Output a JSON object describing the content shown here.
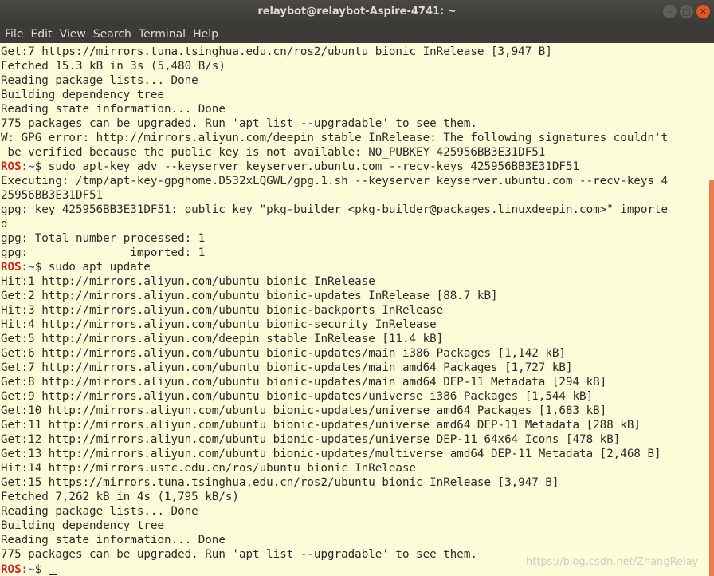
{
  "window": {
    "title": "relaybot@relaybot-Aspire-4741: ~"
  },
  "menu": [
    "File",
    "Edit",
    "View",
    "Search",
    "Terminal",
    "Help"
  ],
  "prompt": {
    "host": "ROS:",
    "path": "~",
    "symbol": "$"
  },
  "lines": [
    {
      "text": "Get:7 https://mirrors.tuna.tsinghua.edu.cn/ros2/ubuntu bionic InRelease [3,947 B]"
    },
    {
      "text": "Fetched 15.3 kB in 3s (5,480 B/s)"
    },
    {
      "text": "Reading package lists... Done"
    },
    {
      "text": "Building dependency tree"
    },
    {
      "text": "Reading state information... Done"
    },
    {
      "text": "775 packages can be upgraded. Run 'apt list --upgradable' to see them."
    },
    {
      "text": "W: GPG error: http://mirrors.aliyun.com/deepin stable InRelease: The following signatures couldn't"
    },
    {
      "text": " be verified because the public key is not available: NO_PUBKEY 425956BB3E31DF51"
    },
    {
      "cmd": "sudo apt-key adv --keyserver keyserver.ubuntu.com --recv-keys 425956BB3E31DF51"
    },
    {
      "text": "Executing: /tmp/apt-key-gpghome.D532xLQGWL/gpg.1.sh --keyserver keyserver.ubuntu.com --recv-keys 4"
    },
    {
      "text": "25956BB3E31DF51"
    },
    {
      "text": "gpg: key 425956BB3E31DF51: public key \"pkg-builder <pkg-builder@packages.linuxdeepin.com>\" importe"
    },
    {
      "text": "d"
    },
    {
      "text": "gpg: Total number processed: 1"
    },
    {
      "text": "gpg:               imported: 1"
    },
    {
      "cmd": "sudo apt update"
    },
    {
      "text": "Hit:1 http://mirrors.aliyun.com/ubuntu bionic InRelease"
    },
    {
      "text": "Get:2 http://mirrors.aliyun.com/ubuntu bionic-updates InRelease [88.7 kB]"
    },
    {
      "text": "Hit:3 http://mirrors.aliyun.com/ubuntu bionic-backports InRelease"
    },
    {
      "text": "Hit:4 http://mirrors.aliyun.com/ubuntu bionic-security InRelease"
    },
    {
      "text": "Get:5 http://mirrors.aliyun.com/deepin stable InRelease [11.4 kB]"
    },
    {
      "text": "Get:6 http://mirrors.aliyun.com/ubuntu bionic-updates/main i386 Packages [1,142 kB]"
    },
    {
      "text": "Get:7 http://mirrors.aliyun.com/ubuntu bionic-updates/main amd64 Packages [1,727 kB]"
    },
    {
      "text": "Get:8 http://mirrors.aliyun.com/ubuntu bionic-updates/main amd64 DEP-11 Metadata [294 kB]"
    },
    {
      "text": "Get:9 http://mirrors.aliyun.com/ubuntu bionic-updates/universe i386 Packages [1,544 kB]"
    },
    {
      "text": "Get:10 http://mirrors.aliyun.com/ubuntu bionic-updates/universe amd64 Packages [1,683 kB]"
    },
    {
      "text": "Get:11 http://mirrors.aliyun.com/ubuntu bionic-updates/universe amd64 DEP-11 Metadata [288 kB]"
    },
    {
      "text": "Get:12 http://mirrors.aliyun.com/ubuntu bionic-updates/universe DEP-11 64x64 Icons [478 kB]"
    },
    {
      "text": "Get:13 http://mirrors.aliyun.com/ubuntu bionic-updates/multiverse amd64 DEP-11 Metadata [2,468 B]"
    },
    {
      "text": "Hit:14 http://mirrors.ustc.edu.cn/ros/ubuntu bionic InRelease"
    },
    {
      "text": "Get:15 https://mirrors.tuna.tsinghua.edu.cn/ros2/ubuntu bionic InRelease [3,947 B]"
    },
    {
      "text": "Fetched 7,262 kB in 4s (1,795 kB/s)"
    },
    {
      "text": "Reading package lists... Done"
    },
    {
      "text": "Building dependency tree"
    },
    {
      "text": "Reading state information... Done"
    },
    {
      "text": "775 packages can be upgraded. Run 'apt list --upgradable' to see them."
    },
    {
      "cmd": ""
    }
  ],
  "watermark": "https://blog.csdn.net/ZhangRelay",
  "colors": {
    "prompt": "#e0201f",
    "path": "#3a6cc9",
    "background": "#fefdd9",
    "scrollbar": "#e9814f"
  }
}
